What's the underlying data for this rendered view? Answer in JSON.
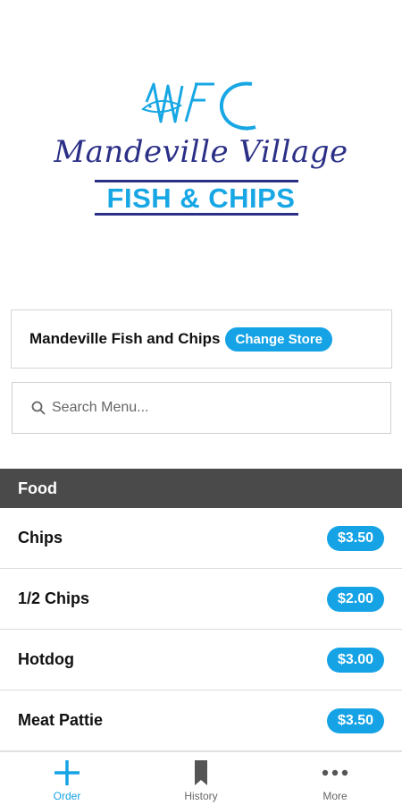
{
  "logo": {
    "monogram": "MVFC",
    "script_text": "Mandeville Village",
    "sub_text": "FISH & CHIPS",
    "colors": {
      "navy": "#2b2f86",
      "blue": "#18a7e4"
    }
  },
  "store": {
    "name": "Mandeville Fish and Chips",
    "change_label": "Change Store"
  },
  "search": {
    "placeholder": "Search Menu...",
    "value": ""
  },
  "menu": {
    "category": "Food",
    "items": [
      {
        "name": "Chips",
        "price": "$3.50"
      },
      {
        "name": "1/2 Chips",
        "price": "$2.00"
      },
      {
        "name": "Hotdog",
        "price": "$3.00"
      },
      {
        "name": "Meat Pattie",
        "price": "$3.50"
      }
    ]
  },
  "tabs": [
    {
      "label": "Order",
      "icon": "plus-icon",
      "active": true
    },
    {
      "label": "History",
      "icon": "bookmark-icon",
      "active": false
    },
    {
      "label": "More",
      "icon": "more-dots-icon",
      "active": false
    }
  ],
  "colors": {
    "accent": "#16a3e6",
    "header_bg": "#4a4a4a"
  }
}
